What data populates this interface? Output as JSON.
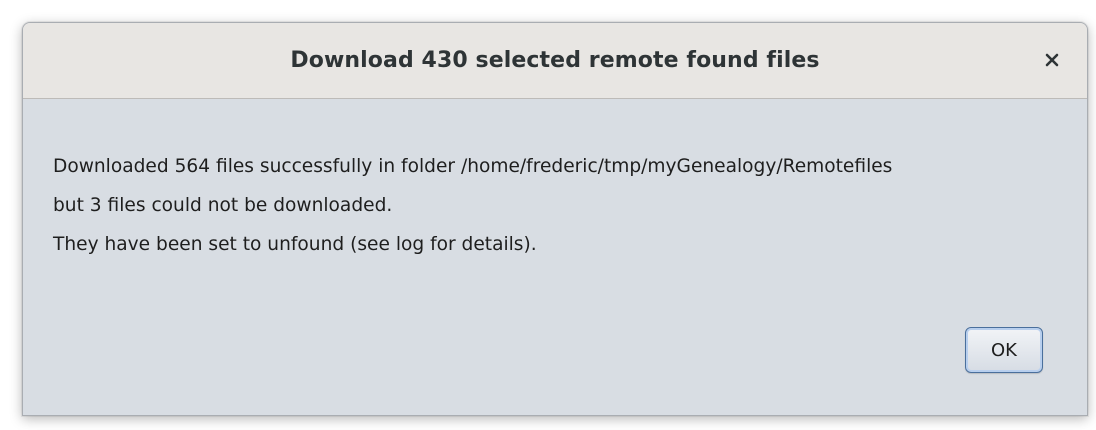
{
  "dialog": {
    "title": "Download 430 selected remote found files",
    "close_icon": "close-icon",
    "message": [
      "Downloaded 564 files successfully in folder /home/frederic/tmp/myGenealogy/Remotefiles",
      "but 3 files could not be downloaded.",
      "They have been set to unfound (see log for details)."
    ],
    "ok_label": "OK"
  },
  "colors": {
    "titlebar_bg": "#e8e6e3",
    "body_bg": "#d8dde3",
    "button_focus_border": "#4a6f9c"
  }
}
